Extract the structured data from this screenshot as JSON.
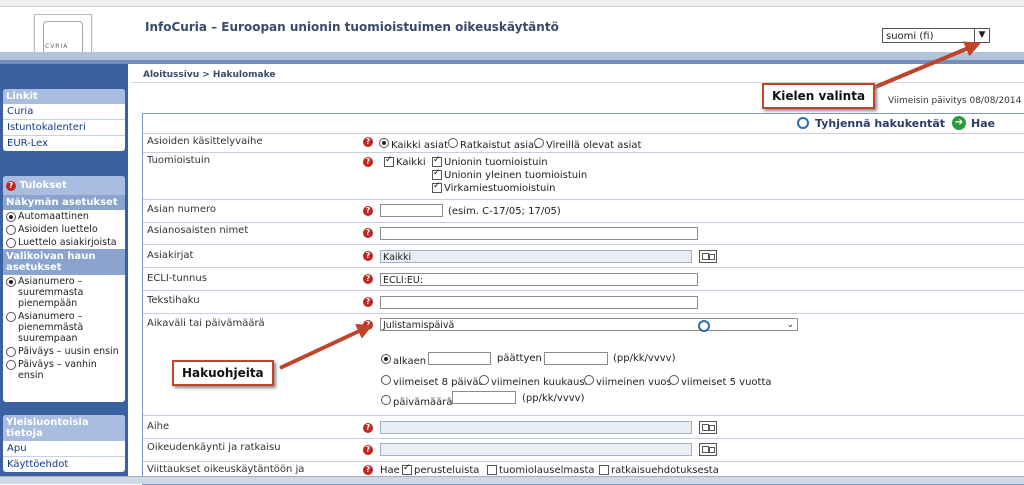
{
  "header": {
    "logo_text": "CVRIA",
    "title": "InfoCuria – Euroopan unionin tuomioistuimen oikeuskäytäntö",
    "language_select": "suomi (fi)"
  },
  "breadcrumb": "Aloitussivu > Hakulomake",
  "last_update": "Viimeisin päivitys 08/08/2014",
  "actions": {
    "clear": "Tyhjennä hakukentät",
    "search": "Hae"
  },
  "sidebar": {
    "links": {
      "title": "Linkit",
      "items": [
        "Curia",
        "Istuntokalenteri",
        "EUR-Lex"
      ]
    },
    "results": {
      "title": "Tulokset",
      "view_title": "Näkymän asetukset",
      "view_options": [
        "Automaattinen",
        "Asioiden luettelo",
        "Luettelo asiakirjoista"
      ],
      "sort_title": "Valikoivan haun asetukset",
      "sort_options": [
        "Asianumero – suuremmasta pienempään",
        "Asianumero – pienemmästä suurempaan",
        "Päiväys – uusin ensin",
        "Päiväys – vanhin ensin"
      ]
    },
    "general": {
      "title": "Yleisluontoisia tietoja",
      "items": [
        "Apu",
        "Käyttöehdot"
      ]
    }
  },
  "form": {
    "stage": {
      "label": "Asioiden käsittelyvaihe",
      "options": [
        "Kaikki asiat",
        "Ratkaistut asiat",
        "Vireillä olevat asiat"
      ]
    },
    "court": {
      "label": "Tuomioistuin",
      "all": "Kaikki",
      "options": [
        "Unionin tuomioistuin",
        "Unionin yleinen tuomioistuin",
        "Virkamiestuomioistuin"
      ]
    },
    "case_number": {
      "label": "Asian numero",
      "hint": "(esim. C-17/05; 17/05)"
    },
    "party_names": {
      "label": "Asianosaisten nimet"
    },
    "documents": {
      "label": "Asiakirjat",
      "value": "Kaikki"
    },
    "ecli": {
      "label": "ECLI-tunnus",
      "value": "ECLI:EU:"
    },
    "text_search": {
      "label": "Tekstihaku"
    },
    "date": {
      "label": "Aikaväli tai päivämäärä",
      "select": "Julistamispäivä",
      "from": "alkaen",
      "to": "päättyen",
      "format": "(pp/kk/vvvv)",
      "periods": [
        "viimeiset 8 päivää",
        "viimeinen kuukausi",
        "viimeinen vuosi",
        "viimeiset 5 vuotta"
      ],
      "on_date": "päivämäärä",
      "format2": "(pp/kk/vvvv)"
    },
    "subject": {
      "label": "Aihe"
    },
    "procedure": {
      "label": "Oikeudenkäynti ja ratkaisu"
    },
    "references": {
      "label": "Viittaukset oikeuskäytäntöön ja",
      "search": "Hae",
      "options": [
        "perusteluista",
        "tuomiolauselmasta",
        "ratkaisuehdotuksesta"
      ]
    }
  },
  "callouts": {
    "language": "Kielen valinta",
    "tips": "Hakuohjeita"
  },
  "colors": {
    "arrow": "#c0442a",
    "sidebar": "#3b629f"
  }
}
